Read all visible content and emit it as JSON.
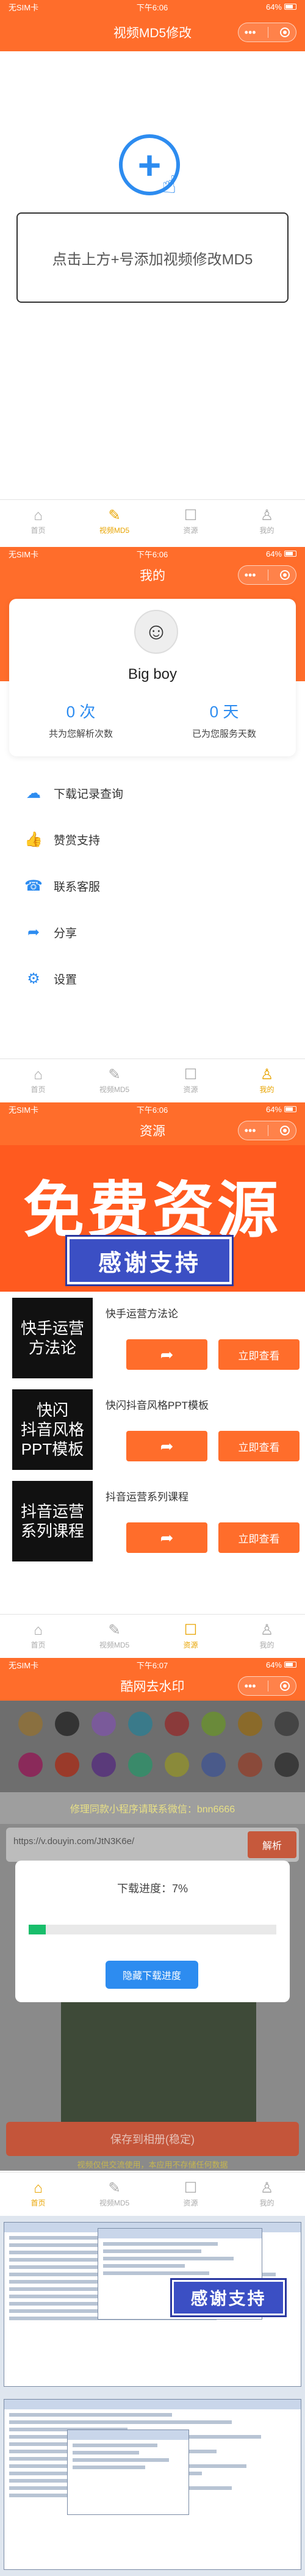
{
  "status": {
    "carrier": "无SIM卡",
    "time1": "下午6:06",
    "time2": "下午6:06",
    "time3": "下午6:06",
    "time4": "下午6:07"
  },
  "screen1": {
    "nav_title": "视频MD5修改",
    "add_prompt": "点击上方+号添加视频修改MD5"
  },
  "tabs": {
    "home": "首页",
    "md5": "视频MD5",
    "resources": "资源",
    "mine": "我的"
  },
  "screen2": {
    "nav_title": "我的",
    "username": "Big boy",
    "parse_count": "0 次",
    "parse_count_label": "共为您解析次数",
    "service_days": "0 天",
    "service_days_label": "已为您服务天数",
    "menu": [
      "下载记录查询",
      "赞赏支持",
      "联系客服",
      "分享",
      "设置"
    ]
  },
  "screen3": {
    "nav_title": "资源",
    "banner_text": "免费资源",
    "banner_thanks": "感谢支持",
    "items": [
      {
        "thumb": "快手运营\n方法论",
        "title": "快手运营方法论",
        "view": "立即查看"
      },
      {
        "thumb": "快闪\n抖音风格\nPPT模板",
        "title": "快闪抖音风格PPT模板",
        "view": "立即查看"
      },
      {
        "thumb": "抖音运营\n系列课程",
        "title": "抖音运营系列课程",
        "view": "立即查看"
      }
    ]
  },
  "screen4": {
    "nav_title": "酷网去水印",
    "tip": "修理同款小程序请联系微信：bnn6666",
    "url": "https://v.douyin.com/JtN3K6e/",
    "parse_btn": "解析",
    "progress_title": "下载进度：7%",
    "progress_value": 7,
    "hide_btn": "隐藏下载进度",
    "save_btn": "保存到相册(稳定)",
    "footer": "视频仅供交流使用，本应用不存储任何数据"
  },
  "screen5": {
    "thanks": "感谢支持"
  },
  "colors": {
    "primary": "#ff6d2b",
    "accent": "#2d8cf0",
    "green": "#19be6b",
    "tab_active": "#e8a400"
  }
}
